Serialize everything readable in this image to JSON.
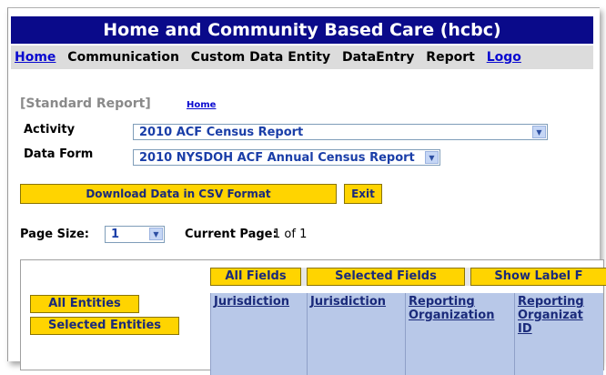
{
  "app": {
    "title": "Home and Community Based Care (hcbc)"
  },
  "menu": {
    "items": [
      "Home",
      "Communication",
      "Custom Data Entity",
      "DataEntry",
      "Report",
      "Logo"
    ]
  },
  "page": {
    "section": "[Standard Report]",
    "home_link": "Home"
  },
  "form": {
    "activity_label": "Activity",
    "activity_value": "2010 ACF Census Report",
    "dataform_label": "Data Form",
    "dataform_value": "2010 NYSDOH ACF Annual Census Report"
  },
  "actions": {
    "download_label": "Download Data in CSV Format",
    "exit_label": "Exit"
  },
  "paging": {
    "page_size_label": "Page Size:",
    "page_size_value": "1",
    "current_page_label": "Current Page:",
    "current_page_value": "1 of 1"
  },
  "grid": {
    "field_buttons": [
      "All Fields",
      "Selected Fields",
      "Show Label F"
    ],
    "entity_buttons": [
      "All Entities",
      "Selected Entities"
    ],
    "columns": [
      "Jurisdiction",
      "Jurisdiction",
      "Reporting Organization",
      "Reporting Organizat ID"
    ]
  },
  "colors": {
    "title_bg": "#0a0a8a",
    "menu_bg": "#dcdcdc",
    "button_bg": "#ffd400",
    "header_bg": "#b8c8e8",
    "link": "#0a0ad0"
  }
}
